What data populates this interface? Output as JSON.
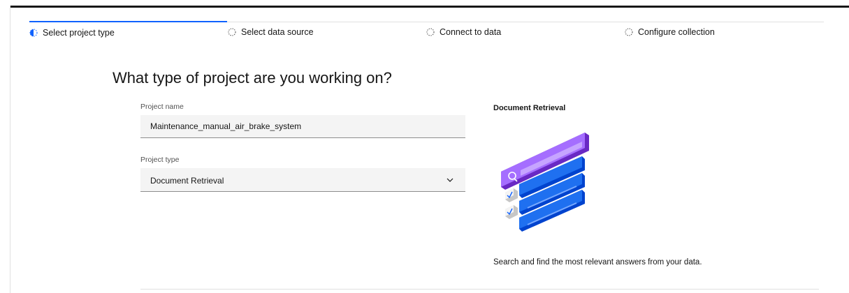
{
  "stepper": {
    "steps": [
      {
        "label": "Select project type",
        "state": "current"
      },
      {
        "label": "Select data source",
        "state": "incomplete"
      },
      {
        "label": "Connect to data",
        "state": "incomplete"
      },
      {
        "label": "Configure collection",
        "state": "incomplete"
      }
    ]
  },
  "main": {
    "heading": "What type of project are you working on?",
    "project_name": {
      "label": "Project name",
      "value": "Maintenance_manual_air_brake_system"
    },
    "project_type": {
      "label": "Project type",
      "value": "Document Retrieval"
    }
  },
  "side": {
    "title": "Document Retrieval",
    "description": "Search and find the most relevant answers from your data."
  },
  "colors": {
    "accent": "#0f62fe",
    "purple": "#8a3ffc",
    "blue": "#0f62fe"
  }
}
